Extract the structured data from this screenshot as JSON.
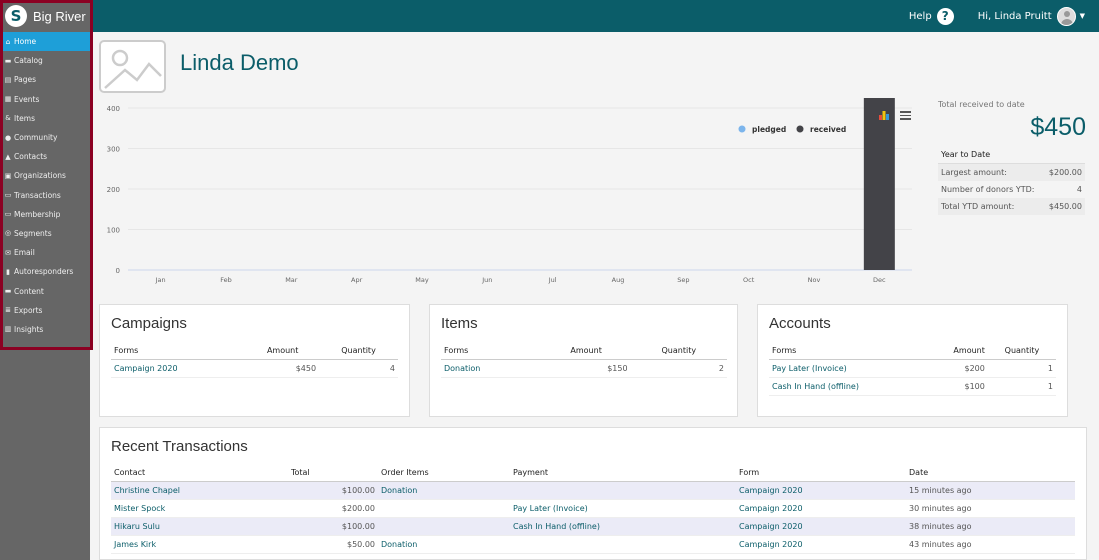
{
  "app": {
    "brand": "Big River",
    "logo_letter": "S"
  },
  "header": {
    "help_label": "Help",
    "help_icon": "?",
    "user_greeting": "Hi, Linda Pruitt",
    "caret": "▼"
  },
  "sidebar": {
    "items": [
      {
        "label": "Home",
        "icon": "home-icon",
        "glyph": "⌂",
        "active": true
      },
      {
        "label": "Catalog",
        "icon": "cart-icon",
        "glyph": "▬",
        "active": false
      },
      {
        "label": "Pages",
        "icon": "pages-icon",
        "glyph": "▤",
        "active": false
      },
      {
        "label": "Events",
        "icon": "calendar-icon",
        "glyph": "▦",
        "active": false
      },
      {
        "label": "Items",
        "icon": "items-icon",
        "glyph": "&",
        "active": false
      },
      {
        "label": "Community",
        "icon": "users-icon",
        "glyph": "●",
        "active": false
      },
      {
        "label": "Contacts",
        "icon": "user-icon",
        "glyph": "▲",
        "active": false
      },
      {
        "label": "Organizations",
        "icon": "building-icon",
        "glyph": "▣",
        "active": false
      },
      {
        "label": "Transactions",
        "icon": "money-icon",
        "glyph": "▭",
        "active": false
      },
      {
        "label": "Membership",
        "icon": "id-card-icon",
        "glyph": "▭",
        "active": false
      },
      {
        "label": "Segments",
        "icon": "target-icon",
        "glyph": "◎",
        "active": false
      },
      {
        "label": "Email",
        "icon": "envelope-icon",
        "glyph": "✉",
        "active": false
      },
      {
        "label": "Autoresponders",
        "icon": "autoresponder-icon",
        "glyph": "▮",
        "active": false
      },
      {
        "label": "Content",
        "icon": "folder-icon",
        "glyph": "▬",
        "active": false
      },
      {
        "label": "Exports",
        "icon": "database-icon",
        "glyph": "≣",
        "active": false
      },
      {
        "label": "Insights",
        "icon": "chart-icon",
        "glyph": "▥",
        "active": false
      }
    ]
  },
  "page": {
    "title": "Linda Demo"
  },
  "chart_data": {
    "type": "bar",
    "categories": [
      "Jan",
      "Feb",
      "Mar",
      "Apr",
      "May",
      "Jun",
      "Jul",
      "Aug",
      "Sep",
      "Oct",
      "Nov",
      "Dec"
    ],
    "series": [
      {
        "name": "pledged",
        "color": "#7cb5ec",
        "values": [
          0,
          0,
          0,
          0,
          0,
          0,
          0,
          0,
          0,
          0,
          0,
          0
        ]
      },
      {
        "name": "received",
        "color": "#434348",
        "values": [
          0,
          0,
          0,
          0,
          0,
          0,
          0,
          0,
          0,
          0,
          0,
          450
        ]
      }
    ],
    "yticks": [
      0,
      100,
      200,
      300,
      400
    ],
    "ylim": [
      0,
      400
    ],
    "legend": "top-right",
    "grid": true
  },
  "stats": {
    "total_label": "Total received to date",
    "total_value": "$450",
    "ytd_title": "Year to Date",
    "rows": [
      {
        "label": "Largest amount:",
        "value": "$200.00"
      },
      {
        "label": "Number of donors YTD:",
        "value": "4"
      },
      {
        "label": "Total YTD amount:",
        "value": "$450.00"
      }
    ]
  },
  "campaigns": {
    "title": "Campaigns",
    "headers": [
      "Forms",
      "Amount",
      "Quantity"
    ],
    "rows": [
      {
        "form": "Campaign 2020",
        "amount": "$450",
        "quantity": "4"
      }
    ]
  },
  "items": {
    "title": "Items",
    "headers": [
      "Forms",
      "Amount",
      "Quantity"
    ],
    "rows": [
      {
        "form": "Donation",
        "amount": "$150",
        "quantity": "2"
      }
    ]
  },
  "accounts": {
    "title": "Accounts",
    "headers": [
      "Forms",
      "Amount",
      "Quantity"
    ],
    "rows": [
      {
        "form": "Pay Later (Invoice)",
        "amount": "$200",
        "quantity": "1"
      },
      {
        "form": "Cash In Hand (offline)",
        "amount": "$100",
        "quantity": "1"
      }
    ]
  },
  "transactions": {
    "title": "Recent Transactions",
    "headers": [
      "Contact",
      "Total",
      "Order Items",
      "Payment",
      "Form",
      "Date"
    ],
    "rows": [
      {
        "contact": "Christine Chapel",
        "total": "$100.00",
        "order_items": "Donation",
        "payment": "",
        "form": "Campaign 2020",
        "date": "15 minutes ago"
      },
      {
        "contact": "Mister Spock",
        "total": "$200.00",
        "order_items": "",
        "payment": "Pay Later (Invoice)",
        "form": "Campaign 2020",
        "date": "30 minutes ago"
      },
      {
        "contact": "Hikaru Sulu",
        "total": "$100.00",
        "order_items": "",
        "payment": "Cash In Hand (offline)",
        "form": "Campaign 2020",
        "date": "38 minutes ago"
      },
      {
        "contact": "James Kirk",
        "total": "$50.00",
        "order_items": "Donation",
        "payment": "",
        "form": "Campaign 2020",
        "date": "43 minutes ago"
      }
    ]
  }
}
